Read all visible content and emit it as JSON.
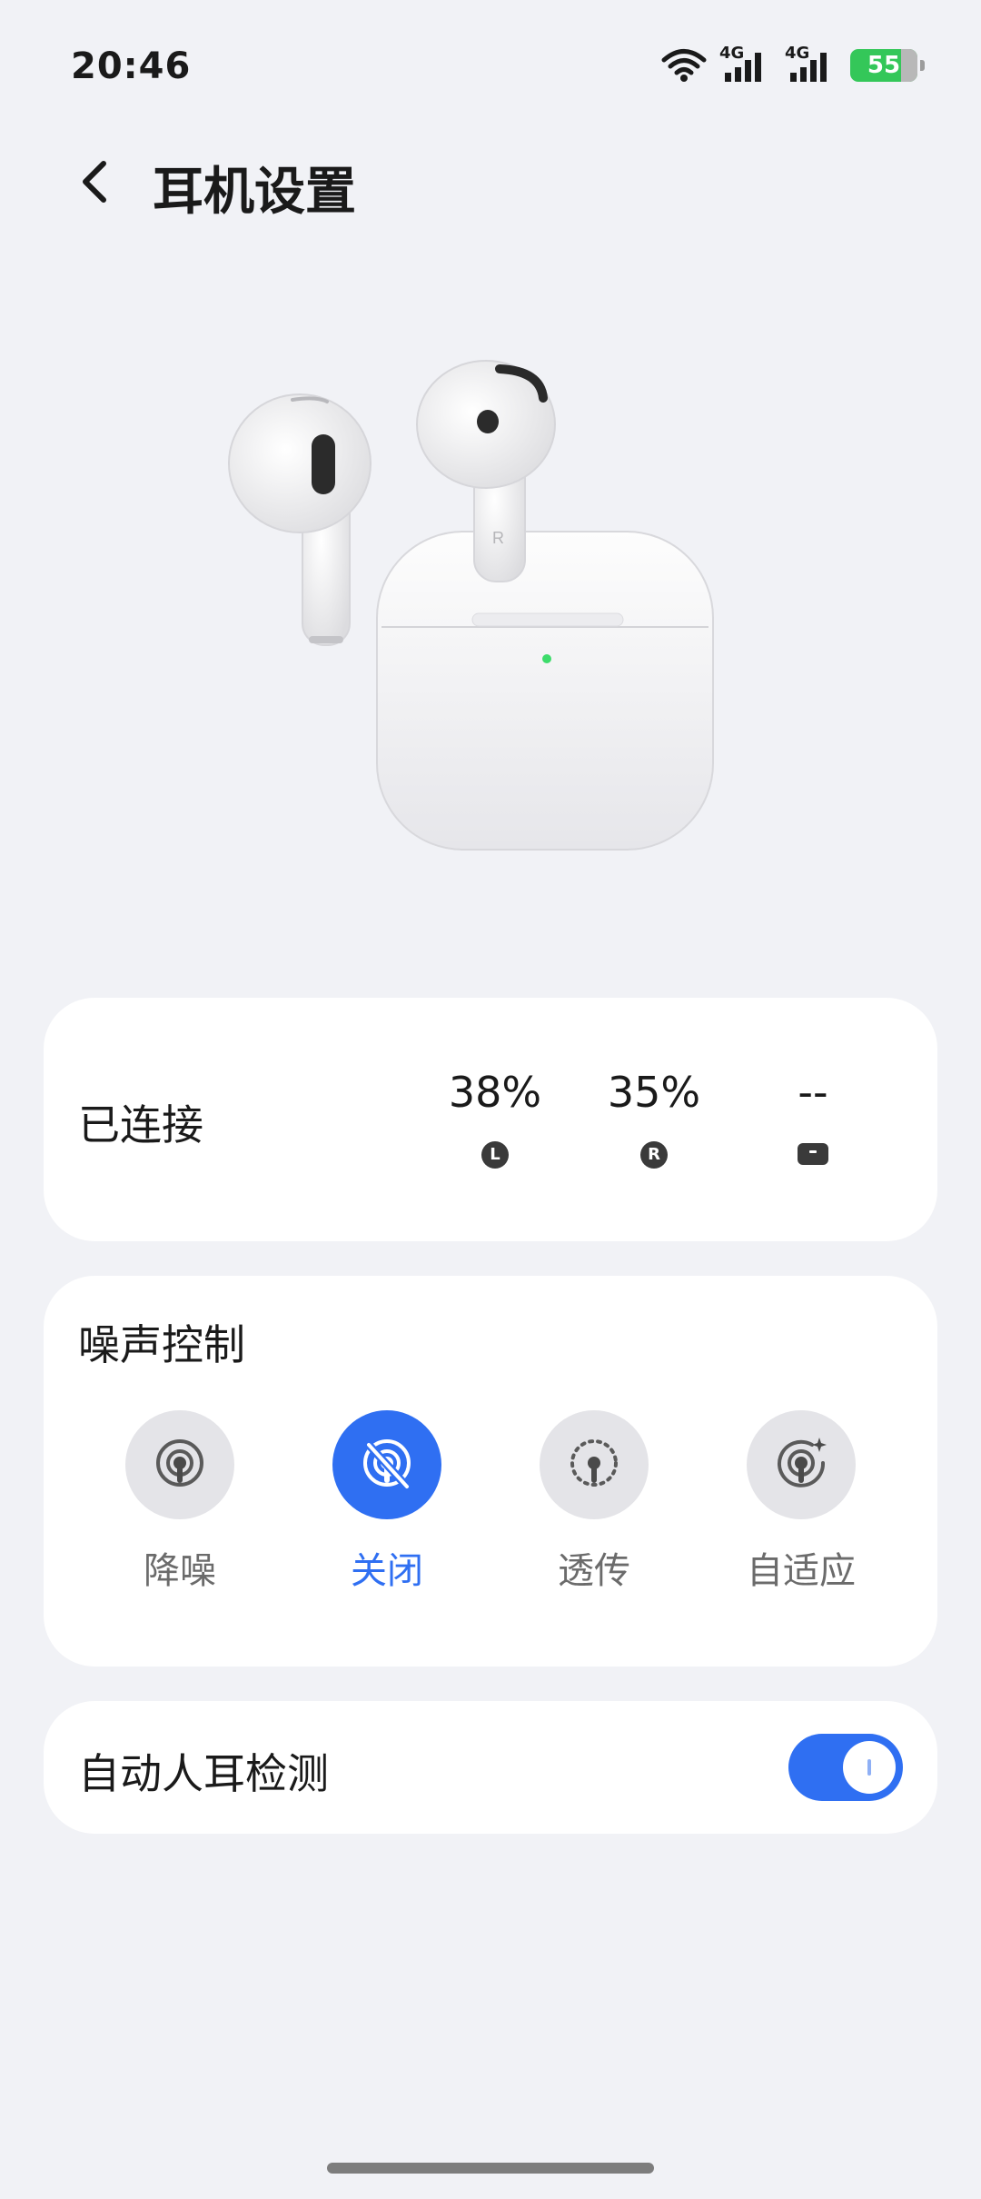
{
  "status_bar": {
    "time": "20:46",
    "network_1": "4G",
    "network_2": "4G",
    "battery_level": "55",
    "icons": [
      "wifi-icon",
      "signal-icon",
      "signal-icon",
      "battery-charging-icon"
    ]
  },
  "header": {
    "title": "耳机设置",
    "back_icon": "chevron-left-icon"
  },
  "device": {
    "image": "earbuds-with-case-illustration",
    "case_led_color": "#3ddc6b"
  },
  "status_card": {
    "label": "已连接",
    "left": {
      "percent": "38%",
      "badge": "L"
    },
    "right": {
      "percent": "35%",
      "badge": "R"
    },
    "case": {
      "percent": "--",
      "icon": "case-icon"
    }
  },
  "noise_control": {
    "title": "噪声控制",
    "modes": [
      {
        "label": "降噪",
        "icon": "noise-cancel-icon",
        "active": false
      },
      {
        "label": "关闭",
        "icon": "noise-off-icon",
        "active": true
      },
      {
        "label": "透传",
        "icon": "transparency-icon",
        "active": false
      },
      {
        "label": "自适应",
        "icon": "adaptive-icon",
        "active": false
      }
    ]
  },
  "ear_detection": {
    "label": "自动人耳检测",
    "enabled": true
  },
  "colors": {
    "accent": "#2f6ff2",
    "background": "#f1f2f6",
    "card": "#ffffff",
    "battery_green": "#34c759"
  }
}
